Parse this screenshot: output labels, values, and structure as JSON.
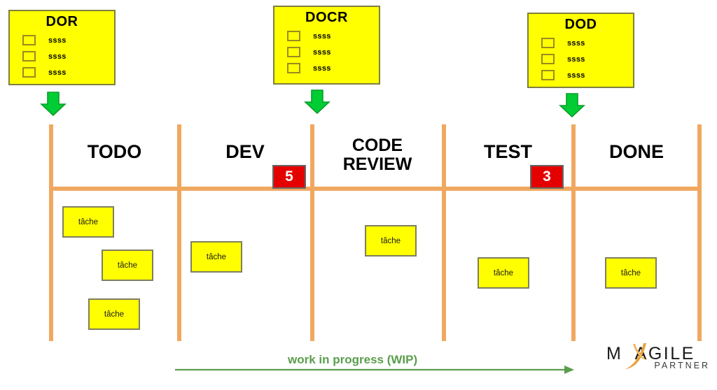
{
  "diagram": {
    "title": "Kanban board with WIP limits",
    "colors": {
      "card_fill": "#ffff00",
      "card_border": "#7f7f5f",
      "divider": "#f0a860",
      "wip_badge": "#e50000",
      "wip_text": "#5a9e4d",
      "arrow_green": "#00cc33",
      "logo_accent": "#e8a33d"
    }
  },
  "policy_cards": [
    {
      "id": "dor",
      "title": "DOR",
      "items": [
        "ssss",
        "ssss",
        "ssss"
      ],
      "arrow_icon": "arrow-down-icon"
    },
    {
      "id": "docr",
      "title": "DOCR",
      "items": [
        "ssss",
        "ssss",
        "ssss"
      ],
      "arrow_icon": "arrow-down-icon"
    },
    {
      "id": "dod",
      "title": "DOD",
      "items": [
        "ssss",
        "ssss",
        "ssss"
      ],
      "arrow_icon": "arrow-down-icon"
    }
  ],
  "columns": [
    {
      "id": "todo",
      "label": "TODO",
      "wip_limit": "",
      "task_count": 3
    },
    {
      "id": "dev",
      "label": "DEV",
      "wip_limit": "5",
      "task_count": 1
    },
    {
      "id": "code-review",
      "label": "CODE\nREVIEW",
      "wip_limit": "",
      "task_count": 1
    },
    {
      "id": "test",
      "label": "TEST",
      "wip_limit": "3",
      "task_count": 1
    },
    {
      "id": "done",
      "label": "DONE",
      "wip_limit": "",
      "task_count": 1
    }
  ],
  "column_labels": {
    "todo": "TODO",
    "dev": "DEV",
    "code_review_line1": "CODE",
    "code_review_line2": "REVIEW",
    "test": "TEST",
    "done": "DONE"
  },
  "wip_limits": {
    "dev": "5",
    "test": "3"
  },
  "tasks": [
    {
      "column": "todo",
      "label": "tâche"
    },
    {
      "column": "todo",
      "label": "tâche"
    },
    {
      "column": "todo",
      "label": "tâche"
    },
    {
      "column": "dev",
      "label": "tâche"
    },
    {
      "column": "code-review",
      "label": "tâche"
    },
    {
      "column": "test",
      "label": "tâche"
    },
    {
      "column": "done",
      "label": "tâche"
    }
  ],
  "footer": {
    "wip_caption": "work in progress (WIP)",
    "arrow_icon": "arrow-right-icon"
  },
  "logo": {
    "main_prefix": "M",
    "main_suffix": "AGILE",
    "sub": "PARTNER",
    "y_icon": "swoosh-y-icon"
  }
}
